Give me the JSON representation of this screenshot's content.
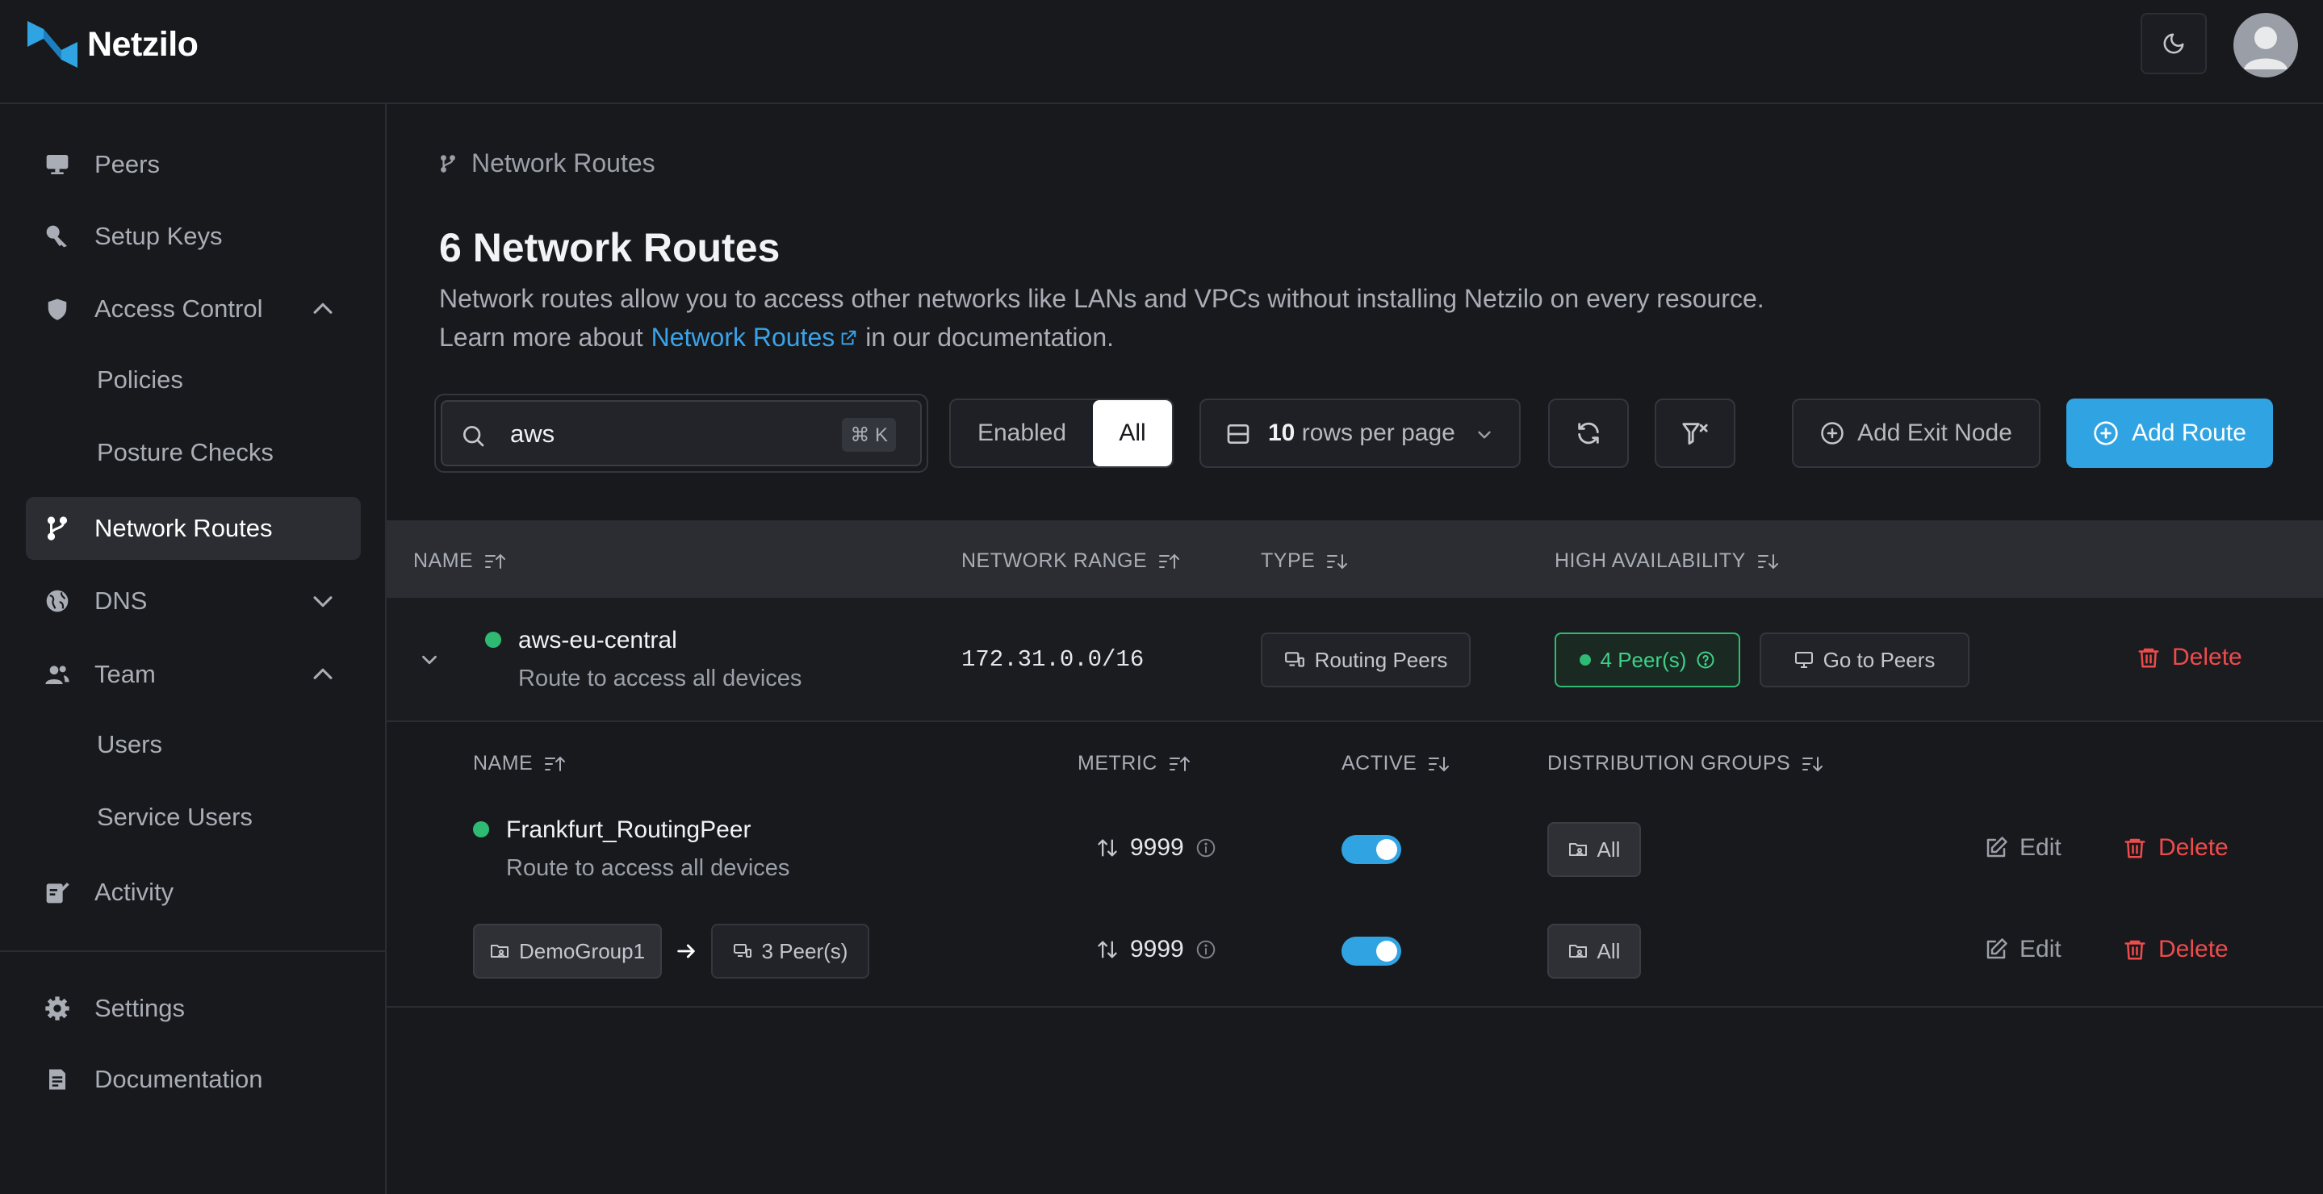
{
  "app": {
    "name": "Netzilo"
  },
  "sidebar": {
    "items": [
      {
        "label": "Peers"
      },
      {
        "label": "Setup Keys"
      },
      {
        "label": "Access Control"
      },
      {
        "label": "Policies"
      },
      {
        "label": "Posture Checks"
      },
      {
        "label": "Network Routes"
      },
      {
        "label": "DNS"
      },
      {
        "label": "Team"
      },
      {
        "label": "Users"
      },
      {
        "label": "Service Users"
      },
      {
        "label": "Activity"
      },
      {
        "label": "Settings"
      },
      {
        "label": "Documentation"
      }
    ],
    "active": "Network Routes"
  },
  "breadcrumb": {
    "label": "Network Routes"
  },
  "page": {
    "title": "6 Network Routes",
    "description": "Network routes allow you to access other networks like LANs and VPCs without installing Netzilo on every resource.",
    "learn_prefix": "Learn more about",
    "learn_link": "Network Routes",
    "learn_suffix": "in our documentation."
  },
  "toolbar": {
    "search_value": "aws",
    "search_shortcut": "⌘ K",
    "filter_enabled": "Enabled",
    "filter_all": "All",
    "rows_count": "10",
    "rows_label": "rows per page",
    "add_exit_node": "Add Exit Node",
    "add_route": "Add Route"
  },
  "table": {
    "headers": {
      "name": "NAME",
      "network_range": "NETWORK RANGE",
      "type": "TYPE",
      "high_availability": "HIGH AVAILABILITY"
    },
    "route": {
      "name": "aws-eu-central",
      "description": "Route to access all devices",
      "network_range": "172.31.0.0/16",
      "type": "Routing Peers",
      "peers": "4 Peer(s)",
      "go_to_peers": "Go to Peers",
      "delete": "Delete"
    },
    "sub_headers": {
      "name": "NAME",
      "metric": "METRIC",
      "active": "ACTIVE",
      "distribution_groups": "DISTRIBUTION GROUPS"
    },
    "sub_rows": [
      {
        "name": "Frankfurt_RoutingPeer",
        "description": "Route to access all devices",
        "metric": "9999",
        "active": true,
        "group": "All",
        "edit": "Edit",
        "delete": "Delete"
      },
      {
        "group_from": "DemoGroup1",
        "peers": "3 Peer(s)",
        "metric": "9999",
        "active": true,
        "group": "All",
        "edit": "Edit",
        "delete": "Delete"
      }
    ]
  }
}
